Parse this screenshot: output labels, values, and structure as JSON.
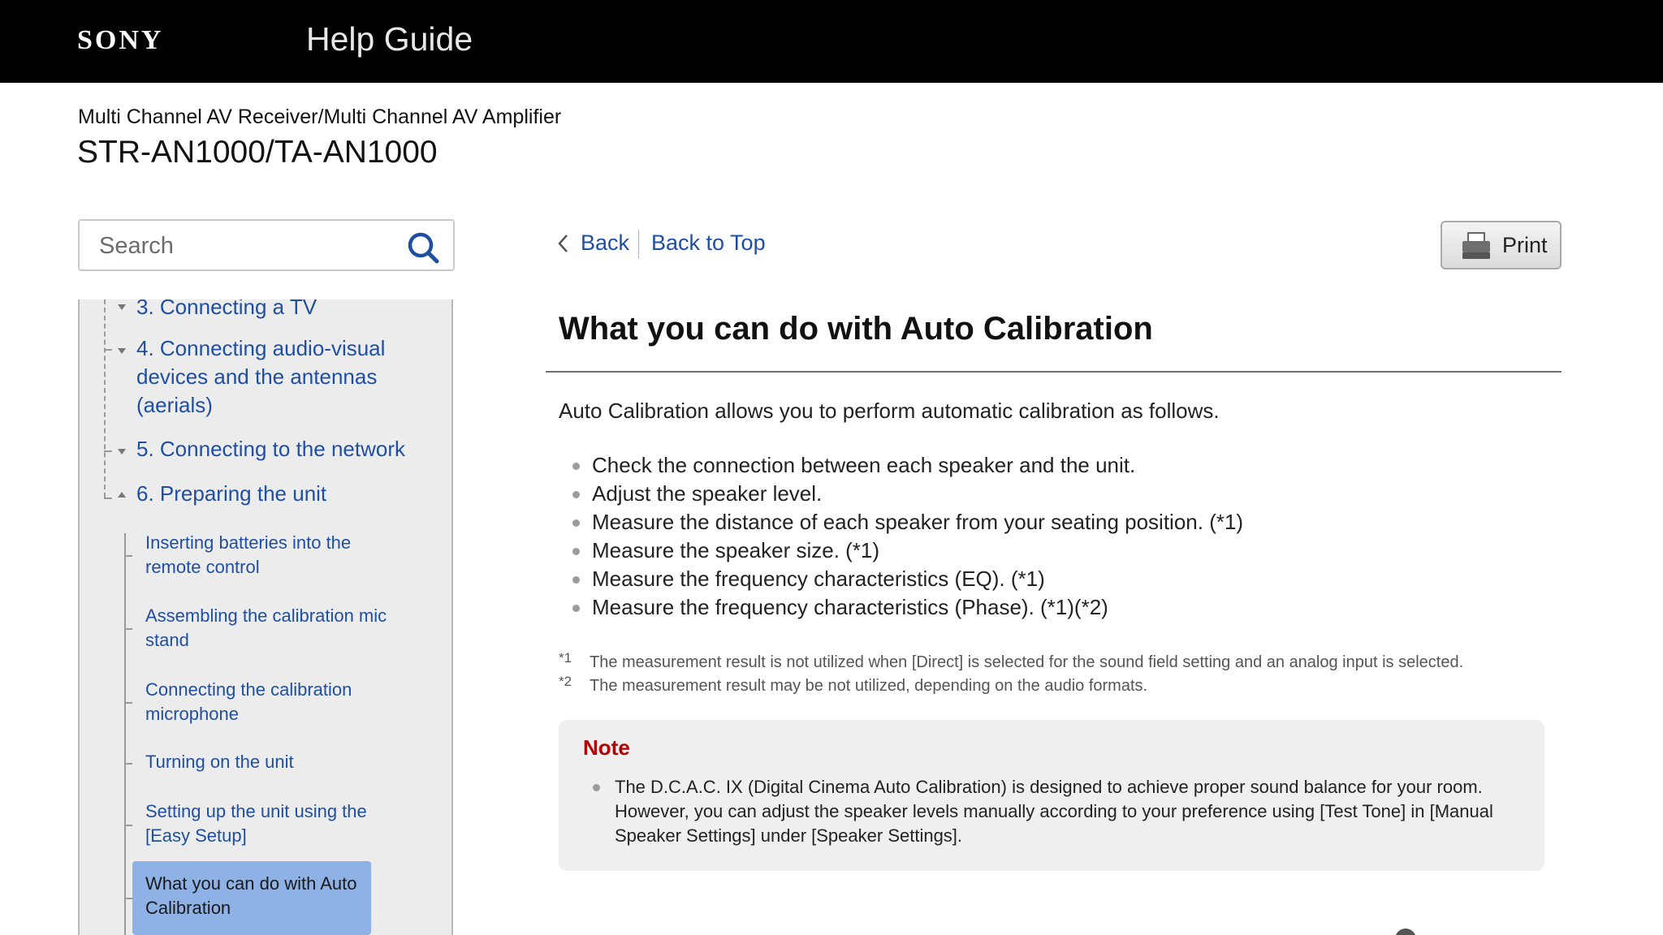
{
  "header": {
    "brand": "SONY",
    "title": "Help Guide"
  },
  "product": {
    "subtitle": "Multi Channel AV Receiver/Multi Channel AV Amplifier",
    "model": "STR-AN1000/TA-AN1000"
  },
  "search": {
    "placeholder": "Search"
  },
  "sidebar": {
    "top_items": [
      {
        "label": "3. Connecting a TV"
      },
      {
        "label": "4. Connecting audio-visual devices and the antennas (aerials)"
      },
      {
        "label": "5. Connecting to the network"
      },
      {
        "label": "6. Preparing the unit"
      }
    ],
    "sub_items": [
      {
        "label": "Inserting batteries into the remote control"
      },
      {
        "label": "Assembling the calibration mic stand"
      },
      {
        "label": "Connecting the calibration microphone"
      },
      {
        "label": "Turning on the unit"
      },
      {
        "label": "Setting up the unit using the [Easy Setup]"
      },
      {
        "label": "What you can do with Auto Calibration"
      }
    ]
  },
  "nav": {
    "back": "Back",
    "back_to_top": "Back to Top",
    "print": "Print"
  },
  "article": {
    "title": "What you can do with Auto Calibration",
    "intro": "Auto Calibration allows you to perform automatic calibration as follows.",
    "bullets": [
      "Check the connection between each speaker and the unit.",
      "Adjust the speaker level.",
      "Measure the distance of each speaker from your seating position. (*1)",
      "Measure the speaker size. (*1)",
      "Measure the frequency characteristics (EQ). (*1)",
      "Measure the frequency characteristics (Phase). (*1)(*2)"
    ],
    "footnotes": [
      {
        "mark": "*1",
        "text": "The measurement result is not utilized when [Direct] is selected for the sound field setting and an analog input is selected."
      },
      {
        "mark": "*2",
        "text": "The measurement result may be not utilized, depending on the audio formats."
      }
    ],
    "note": {
      "heading": "Note",
      "text": "The D.C.A.C. IX (Digital Cinema Auto Calibration) is designed to achieve proper sound balance for your room. However, you can adjust the speaker levels manually according to your preference using [Test Tone] in [Manual Speaker Settings] under [Speaker Settings]."
    }
  },
  "colors": {
    "link": "#1f4fa3",
    "header_bg": "#000000",
    "active_item_bg": "#8fb2e6",
    "note_heading": "#b30000"
  }
}
